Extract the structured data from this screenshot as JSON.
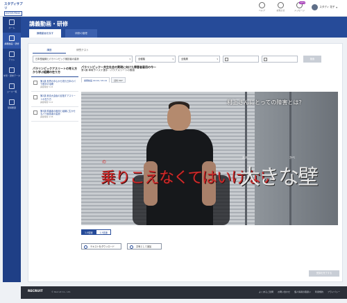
{
  "brand": {
    "line1": "スタディサプリ",
    "line2": "ENTERPRISE"
  },
  "header": {
    "icons": [
      {
        "name": "help-icon",
        "label": "ヘルプ"
      },
      {
        "name": "notice-icon",
        "label": "お知らせ"
      },
      {
        "name": "mail-icon",
        "label": "メッセージ",
        "badge": "NEW"
      }
    ],
    "user_name": "スタディ 花子"
  },
  "sidenav": {
    "items": [
      {
        "label": "ホーム"
      },
      {
        "label": "講義動画・研修"
      },
      {
        "label": "テスト"
      },
      {
        "label": "学習・研修データ"
      },
      {
        "label": "コース一覧"
      },
      {
        "label": "受講履歴"
      }
    ]
  },
  "page": {
    "title": "講義動画・研修",
    "tabs": [
      "講義動画を探す",
      "研修の管理"
    ]
  },
  "subtabs": [
    "講座",
    "研究テスト"
  ],
  "filters": {
    "course": "日本型組織とパラリンピック競技者の姿勢",
    "type": "全種類",
    "level": "全階層",
    "search_label": "検索"
  },
  "course_list": {
    "header": "パラリンピックアスリートの考え方から学ぶ組織の在り方",
    "items": [
      {
        "title": "第1講 世界の中心から見た日本のパラ選手の活躍",
        "duration": "講義時間 5:24"
      },
      {
        "title": "第2講 東京大会後の目指すアスリートの在り方",
        "duration": "講義時間 5:12"
      },
      {
        "title": "第3講 障害者の雇用と組織に生かせるパラ競技者の姿勢",
        "duration": "講義時間 4:38"
      }
    ]
  },
  "main": {
    "series_title": "パラリンピック～共生社会の実現に向けた障害者雇用の今～",
    "episode_title": "第1講 車椅子バスケ選手・パラアスリートの素顔",
    "video_tabs": [
      "講義動画 00:00 / 05:24",
      "資料 PDF"
    ],
    "caption_top": "村上さんにとっての障害とは？",
    "caption_main": "乗りこえなくてはいけない",
    "caption_big": "大きな壁",
    "ruby_no": "の",
    "ruby_oo": "おお",
    "ruby_kabe": "かべ",
    "speed": [
      "1.0倍速",
      "1.5倍速"
    ],
    "btn_download": "テキストをダウンロード",
    "btn_share": "共有として追加",
    "complete_label": "受講を完了する"
  },
  "footer": {
    "logo": "RECRUIT",
    "copyright": "© Recruit Co., Ltd.",
    "links": [
      "よくあるご質問",
      "お問い合わせ",
      "個人情報の取扱い",
      "利用規約",
      "プライバシー"
    ]
  }
}
